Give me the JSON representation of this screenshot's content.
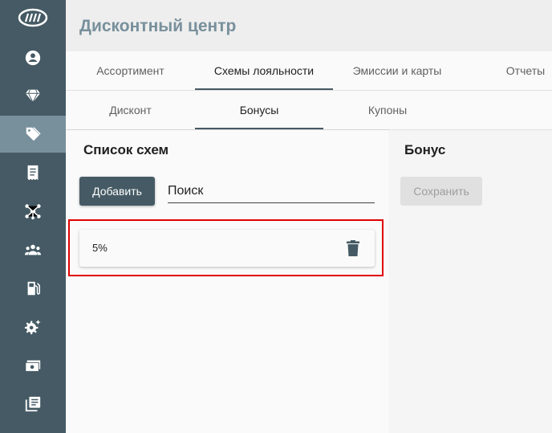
{
  "header": {
    "title": "Дисконтный центр"
  },
  "sidebar": {
    "items": [
      {
        "icon": "account-icon"
      },
      {
        "icon": "diamond-icon"
      },
      {
        "icon": "tags-icon",
        "active": true
      },
      {
        "icon": "receipt-icon"
      },
      {
        "icon": "network-icon"
      },
      {
        "icon": "users-icon"
      },
      {
        "icon": "fuel-icon"
      },
      {
        "icon": "settings-icon"
      },
      {
        "icon": "money-icon"
      },
      {
        "icon": "reports-icon"
      }
    ]
  },
  "tabs_primary": [
    "Ассортимент",
    "Схемы лояльности",
    "Эмиссии и карты",
    "Отчеты"
  ],
  "tabs_secondary": [
    "Дисконт",
    "Бонусы",
    "Купоны"
  ],
  "left_panel": {
    "title": "Список схем",
    "add_label": "Добавить",
    "search_placeholder": "Поиск",
    "schemes": [
      "5%"
    ]
  },
  "right_panel": {
    "title": "Бонус",
    "save_label": "Сохранить"
  },
  "colors": {
    "primary": "#455a64",
    "active_nav": "#78909c",
    "highlight": "#e00000"
  }
}
